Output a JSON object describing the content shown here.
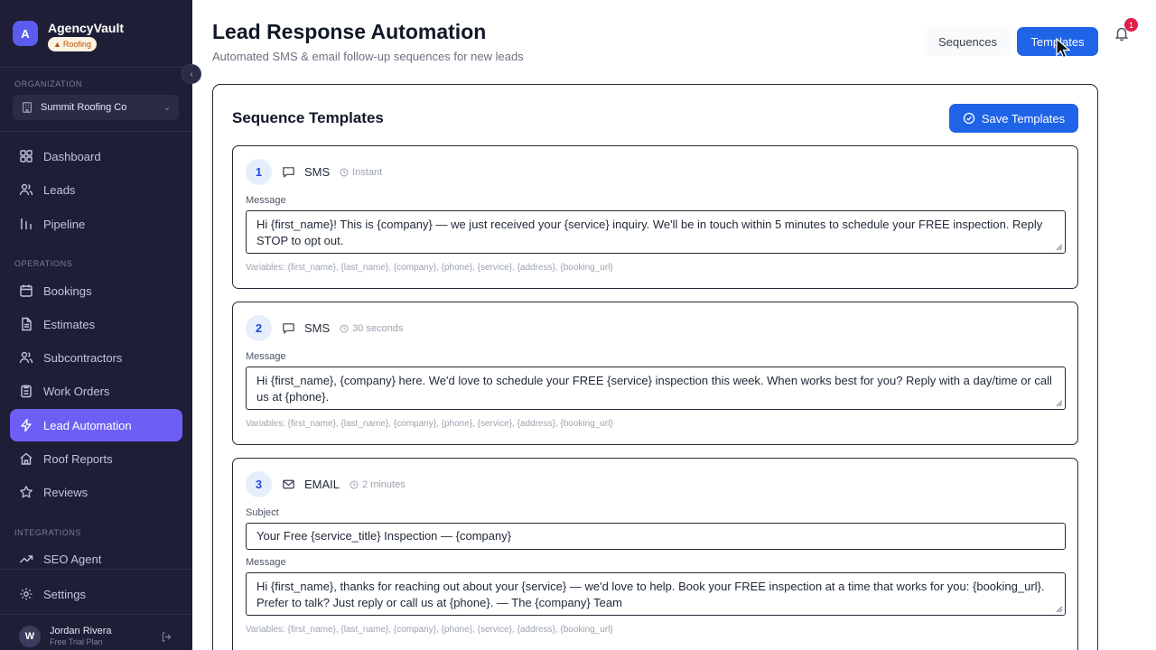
{
  "sidebar": {
    "brand": {
      "initial": "A",
      "name": "AgencyVault",
      "badge": "Roofing"
    },
    "org_label": "ORGANIZATION",
    "org_name": "Summit Roofing Co",
    "items_main": [
      {
        "label": "Dashboard",
        "icon": "dashboard-icon"
      },
      {
        "label": "Leads",
        "icon": "users-icon"
      },
      {
        "label": "Pipeline",
        "icon": "pipeline-icon"
      }
    ],
    "operations_label": "OPERATIONS",
    "items_ops": [
      {
        "label": "Bookings",
        "icon": "calendar-icon"
      },
      {
        "label": "Estimates",
        "icon": "document-icon"
      },
      {
        "label": "Subcontractors",
        "icon": "team-icon"
      },
      {
        "label": "Work Orders",
        "icon": "clipboard-icon"
      },
      {
        "label": "Lead Automation",
        "icon": "lightning-icon",
        "active": true
      },
      {
        "label": "Roof Reports",
        "icon": "home-icon"
      },
      {
        "label": "Reviews",
        "icon": "star-icon"
      }
    ],
    "integrations_label": "INTEGRATIONS",
    "items_integrations": [
      {
        "label": "SEO Agent",
        "icon": "trending-up-icon"
      }
    ],
    "settings_label": "Settings",
    "user": {
      "initial": "W",
      "name": "Jordan Rivera",
      "plan": "Free Trial Plan"
    }
  },
  "header": {
    "title": "Lead Response Automation",
    "subtitle": "Automated SMS & email follow-up sequences for new leads",
    "tabs": [
      {
        "label": "Sequences",
        "active": false
      },
      {
        "label": "Templates",
        "active": true
      }
    ],
    "notification_count": "1"
  },
  "card": {
    "title": "Sequence Templates",
    "save_label": "Save Templates",
    "steps": [
      {
        "number": "1",
        "type": "SMS",
        "delay": "Instant",
        "message_label": "Message",
        "message": "Hi {first_name}! This is {company} — we just received your {service} inquiry. We'll be in touch within 5 minutes to schedule your FREE inspection. Reply STOP to opt out.",
        "variables": "Variables: {first_name}, {last_name}, {company}, {phone}, {service}, {address}, {booking_url}"
      },
      {
        "number": "2",
        "type": "SMS",
        "delay": "30 seconds",
        "message_label": "Message",
        "message": "Hi {first_name}, {company} here. We'd love to schedule your FREE {service} inspection this week. When works best for you? Reply with a day/time or call us at {phone}.",
        "variables": "Variables: {first_name}, {last_name}, {company}, {phone}, {service}, {address}, {booking_url}"
      },
      {
        "number": "3",
        "type": "EMAIL",
        "delay": "2 minutes",
        "subject_label": "Subject",
        "subject": "Your Free {service_title} Inspection — {company}",
        "message_label": "Message",
        "message": "Hi {first_name}, thanks for reaching out about your {service} — we'd love to help. Book your FREE inspection at a time that works for you: {booking_url}. Prefer to talk? Just reply or call us at {phone}. — The {company} Team",
        "variables": "Variables: {first_name}, {last_name}, {company}, {phone}, {service}, {address}, {booking_url}"
      }
    ]
  },
  "colors": {
    "sidebar_bg": "#1e1f36",
    "accent_active": "#6d5ff5",
    "primary_button": "#1f63e6",
    "badge_red": "#e11d48"
  }
}
